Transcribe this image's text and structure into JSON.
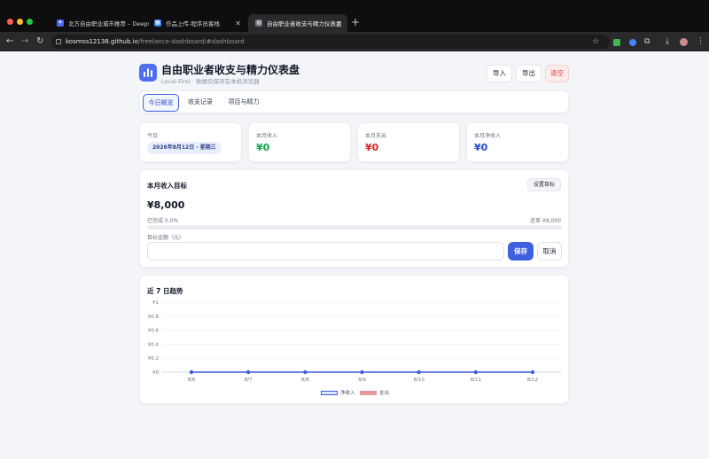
{
  "browser": {
    "tabs": [
      {
        "title": "北方自由职业城市推荐 – Deepse",
        "fav_color": "#4d6bfe",
        "fav_glyph": "✦"
      },
      {
        "title": "作品上传-程序员客栈",
        "fav_color": "#3b82f6",
        "fav_glyph": "▦"
      },
      {
        "title": "自由职业者收支与精力仪表盘",
        "fav_color": "#6b7280",
        "fav_glyph": "◍"
      }
    ],
    "url_host": "kosmos12138.github.io",
    "url_path": "/freelance-dashboard/#dashboard",
    "icons": [
      "back-arrow-icon",
      "forward-arrow-icon",
      "reload-icon",
      "star-icon",
      "extensions-icon",
      "download-icon",
      "profile-icon",
      "menu-icon"
    ]
  },
  "header": {
    "title": "自由职业者收支与精力仪表盘",
    "subtitle": "Local-First · 数据仅保存在本机浏览器",
    "import_label": "导入",
    "export_label": "导出",
    "clear_label": "清空"
  },
  "tabs": {
    "overview": "今日概览",
    "records": "收支记录",
    "projects": "项目与精力"
  },
  "stats": {
    "today_label": "今日",
    "today_value": "2026年8月12日 · 星期三",
    "income_label": "本月收入",
    "income_value": "¥0",
    "income_color": "#16a34a",
    "expense_label": "本月支出",
    "expense_value": "¥0",
    "expense_color": "#dc2626",
    "net_label": "本月净收入",
    "net_value": "¥0",
    "net_color": "#2547d0"
  },
  "goal": {
    "title": "本月收入目标",
    "set_label": "设置目标",
    "amount": "¥8,000",
    "done_text": "已完成 0.0%",
    "remaining_text": "还差 ¥8,000",
    "progress": 0,
    "field_label": "目标金额（元）",
    "field_value": "",
    "save_label": "保存",
    "cancel_label": "取消"
  },
  "trend": {
    "title": "近 7 日趋势",
    "legend_net": "净收入",
    "legend_expense": "支出"
  },
  "chart_data": {
    "type": "line",
    "x": [
      "8/6",
      "8/7",
      "8/8",
      "8/9",
      "8/10",
      "8/11",
      "8/12"
    ],
    "y_ticks": [
      "¥0",
      "¥0.2",
      "¥0.4",
      "¥0.6",
      "¥0.8",
      "¥1"
    ],
    "ylim": [
      0,
      1
    ],
    "series": [
      {
        "name": "净收入",
        "values": [
          0,
          0,
          0,
          0,
          0,
          0,
          0
        ],
        "color": "#3e5fe0"
      },
      {
        "name": "支出",
        "values": [
          0,
          0,
          0,
          0,
          0,
          0,
          0
        ],
        "color": "#e59a9a"
      }
    ],
    "grid": true,
    "legend_position": "bottom"
  }
}
